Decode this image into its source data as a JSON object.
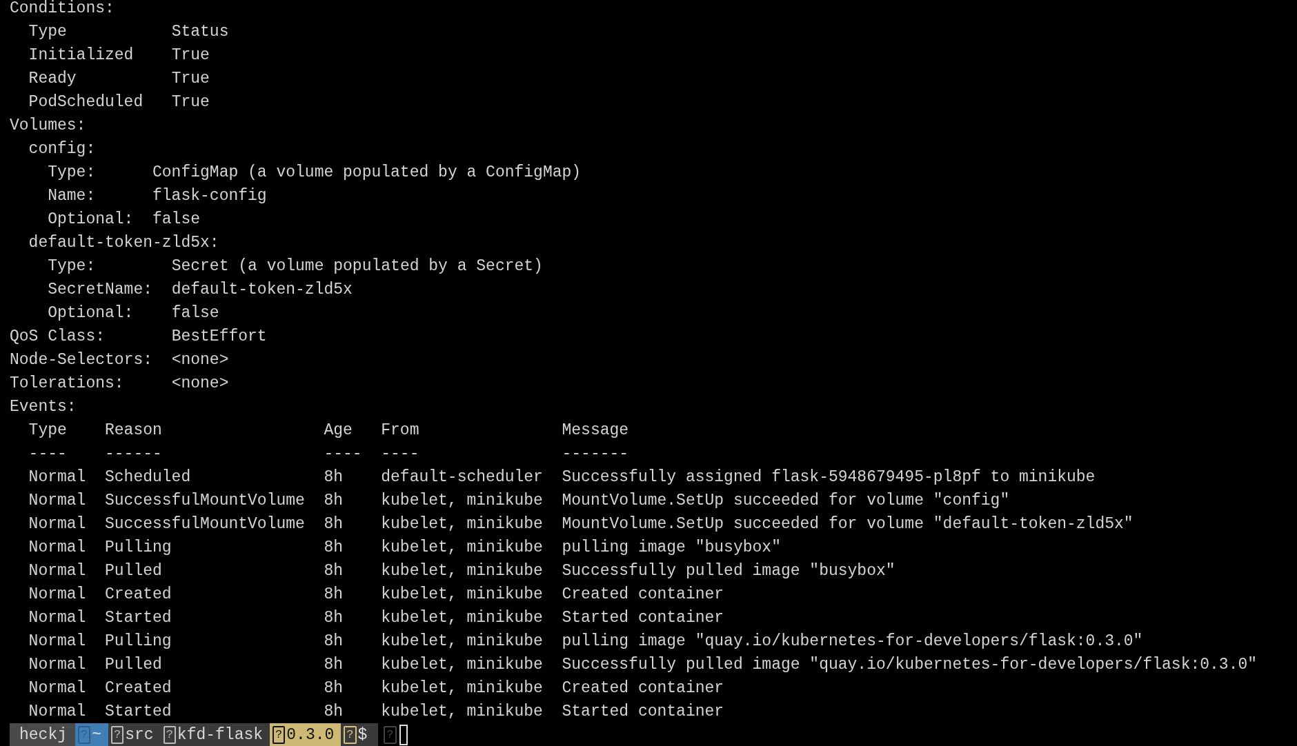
{
  "conditions": {
    "heading": "Conditions:",
    "columns": [
      "Type",
      "Status"
    ],
    "rows": [
      [
        "Initialized",
        "True"
      ],
      [
        "Ready",
        "True"
      ],
      [
        "PodScheduled",
        "True"
      ]
    ]
  },
  "volumes": {
    "heading": "Volumes:",
    "items": [
      {
        "name": "config:",
        "fields": [
          {
            "key": "Type:",
            "value": "ConfigMap (a volume populated by a ConfigMap)"
          },
          {
            "key": "Name:",
            "value": "flask-config"
          },
          {
            "key": "Optional:",
            "value": "false"
          }
        ]
      },
      {
        "name": "default-token-zld5x:",
        "fields": [
          {
            "key": "Type:",
            "value": "Secret (a volume populated by a Secret)"
          },
          {
            "key": "SecretName:",
            "value": "default-token-zld5x"
          },
          {
            "key": "Optional:",
            "value": "false"
          }
        ]
      }
    ]
  },
  "fields": [
    {
      "key": "QoS Class:",
      "value": "BestEffort"
    },
    {
      "key": "Node-Selectors:",
      "value": "<none>"
    },
    {
      "key": "Tolerations:",
      "value": "<none>"
    }
  ],
  "events": {
    "heading": "Events:",
    "columns": [
      "Type",
      "Reason",
      "Age",
      "From",
      "Message"
    ],
    "dashes": [
      "----",
      "------",
      "----",
      "----",
      "-------"
    ],
    "rows": [
      [
        "Normal",
        "Scheduled",
        "8h",
        "default-scheduler",
        "Successfully assigned flask-5948679495-pl8pf to minikube"
      ],
      [
        "Normal",
        "SuccessfulMountVolume",
        "8h",
        "kubelet, minikube",
        "MountVolume.SetUp succeeded for volume \"config\""
      ],
      [
        "Normal",
        "SuccessfulMountVolume",
        "8h",
        "kubelet, minikube",
        "MountVolume.SetUp succeeded for volume \"default-token-zld5x\""
      ],
      [
        "Normal",
        "Pulling",
        "8h",
        "kubelet, minikube",
        "pulling image \"busybox\""
      ],
      [
        "Normal",
        "Pulled",
        "8h",
        "kubelet, minikube",
        "Successfully pulled image \"busybox\""
      ],
      [
        "Normal",
        "Created",
        "8h",
        "kubelet, minikube",
        "Created container"
      ],
      [
        "Normal",
        "Started",
        "8h",
        "kubelet, minikube",
        "Started container"
      ],
      [
        "Normal",
        "Pulling",
        "8h",
        "kubelet, minikube",
        "pulling image \"quay.io/kubernetes-for-developers/flask:0.3.0\""
      ],
      [
        "Normal",
        "Pulled",
        "8h",
        "kubelet, minikube",
        "Successfully pulled image \"quay.io/kubernetes-for-developers/flask:0.3.0\""
      ],
      [
        "Normal",
        "Created",
        "8h",
        "kubelet, minikube",
        "Created container"
      ],
      [
        "Normal",
        "Started",
        "8h",
        "kubelet, minikube",
        "Started container"
      ]
    ]
  },
  "prompt": {
    "segments": [
      {
        "kind": "user",
        "text": "heckj"
      },
      {
        "kind": "home",
        "glyph": "?",
        "text": "~"
      },
      {
        "kind": "dir",
        "glyph": "?",
        "text": "src"
      },
      {
        "kind": "dir",
        "glyph": "?",
        "text": "kfd-flask"
      },
      {
        "kind": "version",
        "glyph": "?",
        "text": "0.3.0"
      },
      {
        "kind": "symbol",
        "glyph": "?",
        "text": "$"
      }
    ],
    "trailing_glyph": "?"
  }
}
